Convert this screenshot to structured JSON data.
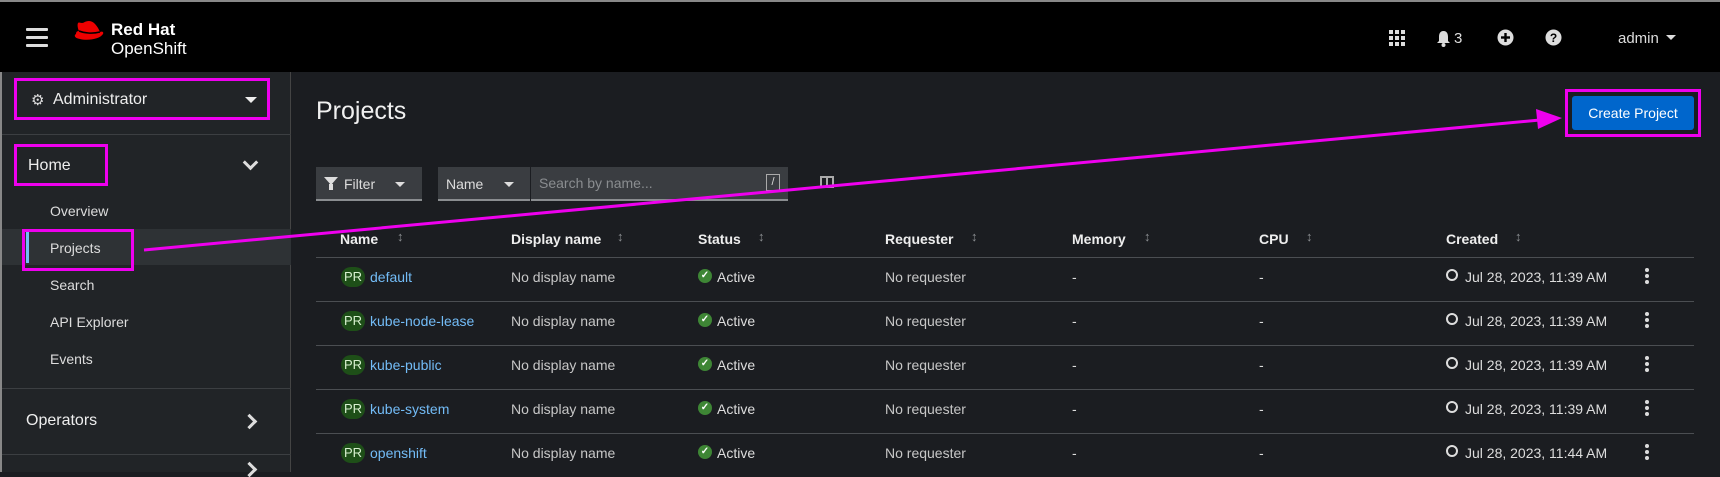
{
  "masthead": {
    "brand_line1": "Red Hat",
    "brand_line2": "OpenShift",
    "notification_count": "3",
    "user": "admin"
  },
  "sidebar": {
    "perspective": "Administrator",
    "home_label": "Home",
    "home_items": [
      "Overview",
      "Projects",
      "Search",
      "API Explorer",
      "Events"
    ],
    "operators_label": "Operators"
  },
  "page": {
    "title": "Projects",
    "create_button": "Create Project"
  },
  "toolbar": {
    "filter_label": "Filter",
    "name_select": "Name",
    "search_placeholder": "Search by name...",
    "search_shortcut": "/"
  },
  "table": {
    "columns": [
      "Name",
      "Display name",
      "Status",
      "Requester",
      "Memory",
      "CPU",
      "Created"
    ],
    "rows": [
      {
        "badge": "PR",
        "name": "default",
        "display_name": "No display name",
        "status": "Active",
        "requester": "No requester",
        "memory": "-",
        "cpu": "-",
        "created": "Jul 28, 2023, 11:39 AM"
      },
      {
        "badge": "PR",
        "name": "kube-node-lease",
        "display_name": "No display name",
        "status": "Active",
        "requester": "No requester",
        "memory": "-",
        "cpu": "-",
        "created": "Jul 28, 2023, 11:39 AM"
      },
      {
        "badge": "PR",
        "name": "kube-public",
        "display_name": "No display name",
        "status": "Active",
        "requester": "No requester",
        "memory": "-",
        "cpu": "-",
        "created": "Jul 28, 2023, 11:39 AM"
      },
      {
        "badge": "PR",
        "name": "kube-system",
        "display_name": "No display name",
        "status": "Active",
        "requester": "No requester",
        "memory": "-",
        "cpu": "-",
        "created": "Jul 28, 2023, 11:39 AM"
      },
      {
        "badge": "PR",
        "name": "openshift",
        "display_name": "No display name",
        "status": "Active",
        "requester": "No requester",
        "memory": "-",
        "cpu": "-",
        "created": "Jul 28, 2023, 11:44 AM"
      }
    ]
  },
  "colors": {
    "accent_blue": "#0066cc",
    "link_blue": "#73bcf7",
    "annotation_magenta": "#ee00ee",
    "status_green": "#3e8635"
  }
}
